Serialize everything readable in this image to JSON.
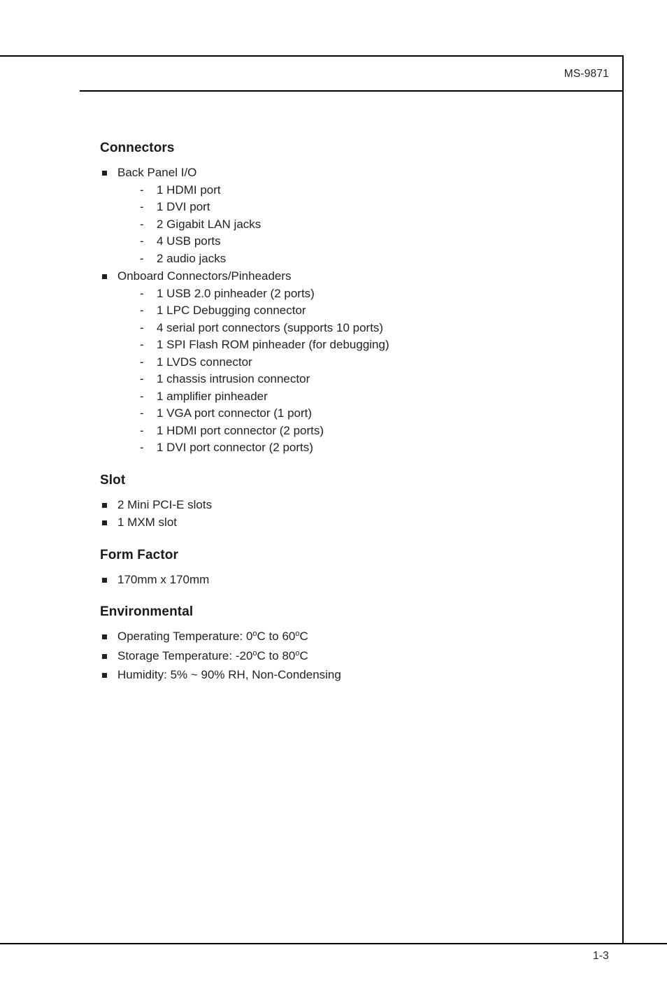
{
  "header": {
    "model": "MS-9871"
  },
  "footer": {
    "page_number": "1-3"
  },
  "sections": [
    {
      "heading": "Connectors",
      "groups": [
        {
          "label": "Back Panel I/O",
          "items": [
            "1 HDMI port",
            "1 DVI port",
            "2 Gigabit LAN jacks",
            "4 USB ports",
            "2 audio jacks"
          ]
        },
        {
          "label": "Onboard Connectors/Pinheaders",
          "items": [
            "1 USB 2.0 pinheader (2 ports)",
            "1 LPC Debugging connector",
            "4 serial port connectors (supports 10 ports)",
            "1 SPI Flash ROM pinheader (for debugging)",
            "1 LVDS connector",
            "1 chassis intrusion connector",
            "1 amplifier pinheader",
            "1 VGA port connector (1 port)",
            "1 HDMI port connector (2 ports)",
            "1 DVI port connector (2 ports)"
          ]
        }
      ]
    },
    {
      "heading": "Slot",
      "bullets": [
        "2 Mini PCI-E slots",
        "1 MXM slot"
      ]
    },
    {
      "heading": "Form Factor",
      "bullets": [
        "170mm x 170mm"
      ]
    },
    {
      "heading": "Environmental",
      "bullets_rich": [
        {
          "prefix": "Operating Temperature: 0",
          "deg1": "o",
          "mid": "C to 60",
          "deg2": "o",
          "suffix": "C"
        },
        {
          "prefix": "Storage Temperature: -20",
          "deg1": "o",
          "mid": "C to 80",
          "deg2": "o",
          "suffix": "C"
        }
      ],
      "bullets_plain": [
        "Humidity: 5% ~ 90% RH, Non-Condensing"
      ]
    }
  ]
}
